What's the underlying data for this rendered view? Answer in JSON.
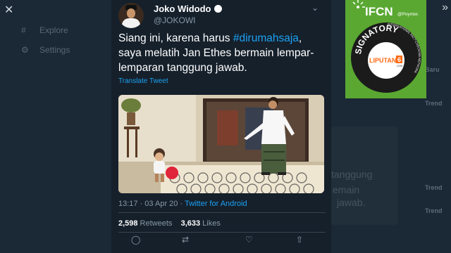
{
  "left_nav": {
    "items": [
      {
        "label": "Explore",
        "icon": "hashtag-icon"
      },
      {
        "label": "Settings",
        "icon": "gear-icon"
      }
    ]
  },
  "tweet": {
    "author_name": "Joko Widodo",
    "handle": "@JOKOWI",
    "text_before": "Siang ini, karena harus ",
    "hashtag": "#dirumahsaja",
    "text_after": ", saya melatih Jan Ethes bermain lempar-lemparan tanggung jawab.",
    "translate_label": "Translate Tweet",
    "time": "13:17 · 03 Apr 20 · ",
    "source": "Twitter for Android",
    "retweets_count": "2,598",
    "retweets_label": "Retweets",
    "likes_count": "3,633",
    "likes_label": "Likes"
  },
  "background_ghost": {
    "lines": [
      "emain",
      "jawab.",
      "tanggung"
    ],
    "right_labels": [
      "Baru",
      "Trend",
      "Trend",
      "Trend"
    ]
  },
  "badge": {
    "ifcn": "IFCN",
    "poynter": "@Poynter.",
    "signatory": "SIGNATORY",
    "network": "INTERNATIONAL FACT-CHECKING NETWORK",
    "brand": "LIPUTAN",
    "brand_num": "6",
    "brand_sub": ".COM",
    "colors": {
      "green": "#5aa832",
      "dark": "#1b1b1b",
      "brand_orange": "#ff6a13"
    }
  }
}
